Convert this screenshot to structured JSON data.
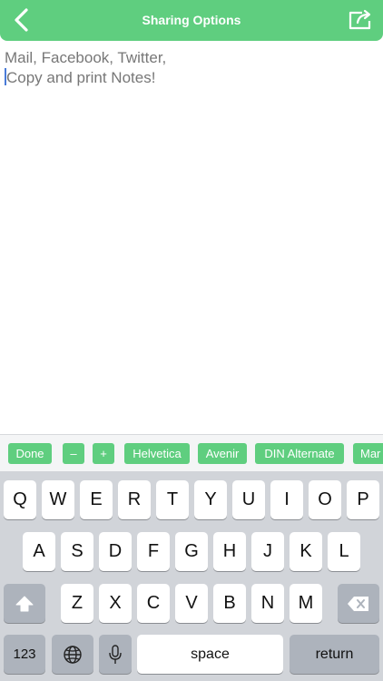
{
  "navbar": {
    "title": "Sharing Options",
    "back_icon": "chevron-left-icon",
    "share_icon": "share-icon",
    "color": "#5fce7f"
  },
  "note": {
    "lines": [
      "Mail, Facebook, Twitter,",
      "Copy and print Notes!"
    ]
  },
  "toolbar": {
    "done": "Done",
    "minus": "–",
    "plus": "+",
    "fonts": [
      "Helvetica",
      "Avenir",
      "DIN Alternate",
      "Mar"
    ]
  },
  "keyboard": {
    "row1": [
      "Q",
      "W",
      "E",
      "R",
      "T",
      "Y",
      "U",
      "I",
      "O",
      "P"
    ],
    "row2": [
      "A",
      "S",
      "D",
      "F",
      "G",
      "H",
      "J",
      "K",
      "L"
    ],
    "row3": [
      "Z",
      "X",
      "C",
      "V",
      "B",
      "N",
      "M"
    ],
    "numbers_key": "123",
    "space_key": "space",
    "return_key": "return",
    "shift_icon": "shift-icon",
    "delete_icon": "delete-icon",
    "globe_icon": "globe-icon",
    "mic_icon": "microphone-icon"
  }
}
